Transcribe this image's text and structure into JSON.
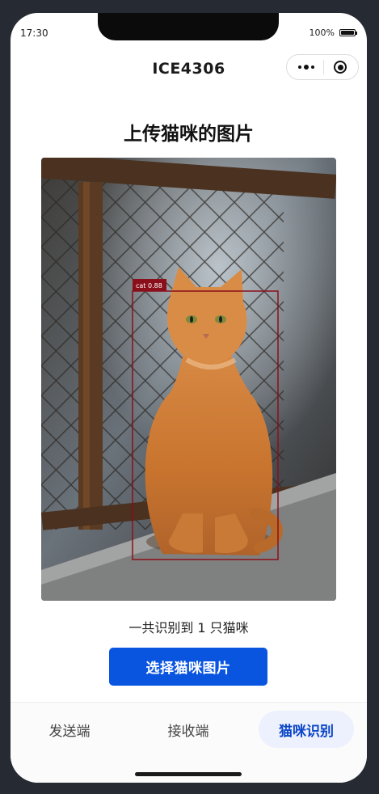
{
  "status_bar": {
    "time": "17:30",
    "battery_text": "100%",
    "battery_level": 1.0
  },
  "nav": {
    "title": "ICE4306",
    "more_icon": "more-dots-icon",
    "close_icon": "target-circle-icon"
  },
  "page": {
    "title": "上传猫咪的图片",
    "detection_label": "cat 0.88",
    "result_text": "一共识别到 1 只猫咪",
    "select_button": "选择猫咪图片"
  },
  "tabs": [
    {
      "label": "发送端",
      "active": false
    },
    {
      "label": "接收端",
      "active": false
    },
    {
      "label": "猫咪识别",
      "active": true
    }
  ],
  "colors": {
    "accent": "#0a55e0",
    "active_tab_bg": "#edf0fd",
    "box": "#8b0f1a"
  }
}
